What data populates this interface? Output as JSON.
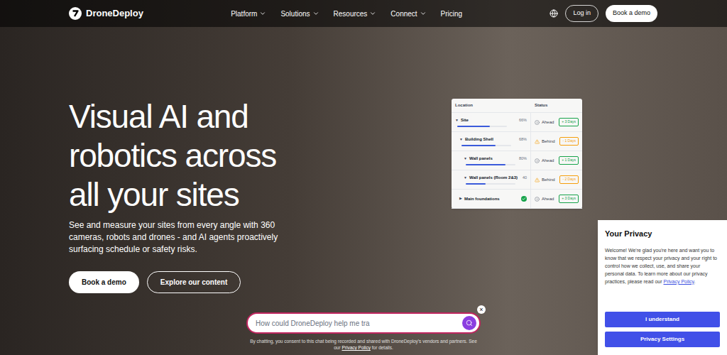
{
  "nav": {
    "brand": "DroneDeploy",
    "items": [
      {
        "label": "Platform",
        "has_menu": true
      },
      {
        "label": "Solutions",
        "has_menu": true
      },
      {
        "label": "Resources",
        "has_menu": true
      },
      {
        "label": "Connect",
        "has_menu": true
      },
      {
        "label": "Pricing",
        "has_menu": false
      }
    ],
    "login": "Log in",
    "cta": "Book a demo"
  },
  "hero": {
    "title_lines": [
      "Visual AI and",
      "robotics across",
      "all your sites"
    ],
    "subtitle": "See and measure your sites from every angle with 360 cameras, robots and drones - and AI agents proactively surfacing schedule or safety risks.",
    "buttons": [
      {
        "label": "Book a demo",
        "kind": "primary"
      },
      {
        "label": "Explore our content",
        "kind": "outline"
      }
    ]
  },
  "status_card": {
    "columns": [
      "Location",
      "Status"
    ],
    "rows": [
      {
        "name": "Site",
        "indent": 0,
        "caret": "▼",
        "kind": "progress",
        "percent": "66%",
        "level": 0.66,
        "status": "Ahead",
        "badge": "+ 3 Days",
        "color": "#16a34a"
      },
      {
        "name": "Building Shell",
        "indent": 1,
        "caret": "▼",
        "kind": "progress",
        "percent": "68%",
        "level": 0.68,
        "status": "Behind",
        "badge": "- 1 Days",
        "color": "#f59e0b"
      },
      {
        "name": "Wall panels",
        "indent": 2,
        "caret": "▼",
        "kind": "progress",
        "percent": "80%",
        "level": 0.8,
        "status": "Ahead",
        "badge": "+ 1 Days",
        "color": "#16a34a"
      },
      {
        "name": "Wall panels (Room 2&3)",
        "indent": 2,
        "caret": "▼",
        "kind": "progress",
        "percent": "40",
        "level": 0.4,
        "status": "Behind",
        "badge": "- 2 Days",
        "color": "#f59e0b"
      },
      {
        "name": "Main foundations",
        "indent": 1,
        "caret": "▶",
        "kind": "done",
        "status": "Ahead",
        "badge": "+ 3 Days",
        "color": "#16a34a"
      }
    ]
  },
  "chat": {
    "value": "How could DroneDeploy help me tra",
    "close": "×",
    "disclaimer": "By chatting, you consent to this chat being recorded and shared with DroneDeploy's vendors and partners. See our",
    "disclaimer_link": "Privacy Policy",
    "disclaimer_end": "for details."
  },
  "privacy": {
    "title": "Your Privacy",
    "body": "Welcome! We're glad you're here and want you to know that we respect your privacy and your right to control how we collect, use, and share your personal data. To learn more about our privacy practices, please read our",
    "link": "Privacy Policy",
    "link_end": ".",
    "buttons": [
      "I understand",
      "Privacy Settings"
    ]
  }
}
